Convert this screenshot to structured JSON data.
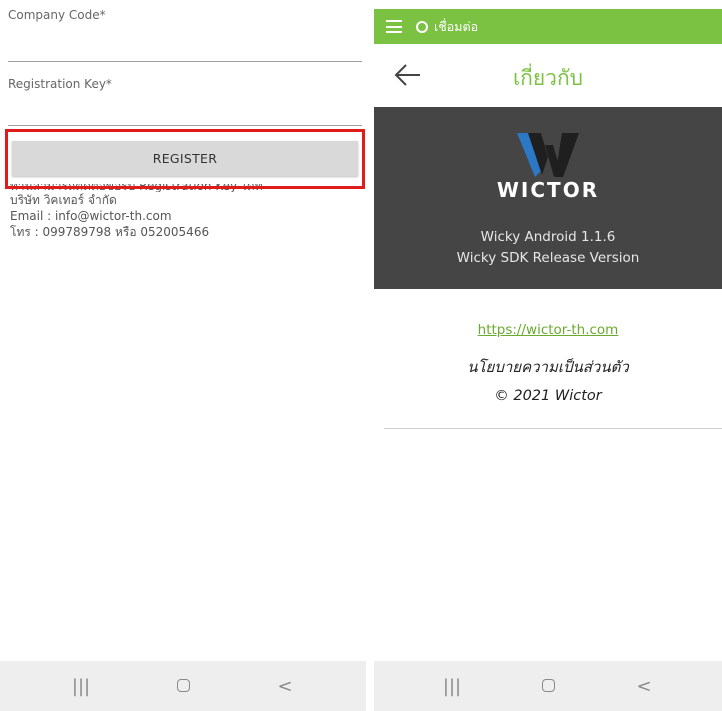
{
  "left_screen": {
    "form": {
      "company_code_label": "Company Code*",
      "company_code_value": "",
      "registration_key_label": "Registration Key*",
      "registration_key_value": ""
    },
    "register_button_label": "REGISTER",
    "contact_info": [
      "ท่านสามารถติดต่อขอรับ Registration Key ได้ที่",
      "บริษัท วิคเทอร์ จำกัด",
      "Email : info@wictor-th.com",
      "โทร : 099789798 หรือ 052005466"
    ],
    "highlight_color": "#e01b1b"
  },
  "right_screen": {
    "app_bar": {
      "menu_icon": "hamburger-menu-icon",
      "status_icon": "circle-status-icon",
      "status_text": "เชื่อมต่อ",
      "color": "#7cc242"
    },
    "page_title": "เกี่ยวกับ",
    "back_icon": "arrow-left-icon",
    "brand": {
      "logo_text": "WICTOR",
      "app_version": "Wicky Android 1.1.6",
      "sdk_version": "Wicky SDK  Release Version"
    },
    "website_link": "https://wictor-th.com",
    "privacy_policy": "นโยบายความเป็นส่วนตัว",
    "copyright": "© 2021 Wictor"
  },
  "system_nav": {
    "recents_icon": "|||",
    "home_icon": "home-icon",
    "back_icon": "<"
  }
}
